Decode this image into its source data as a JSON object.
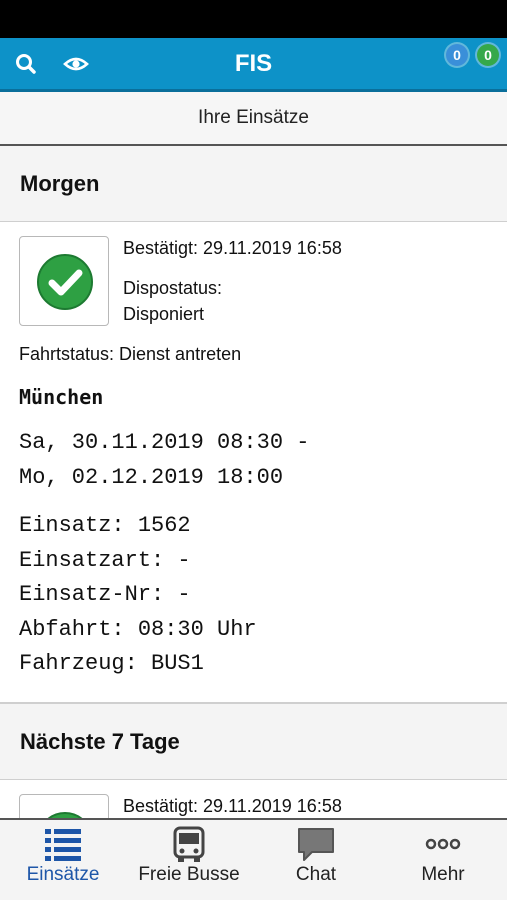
{
  "app": {
    "title": "FIS"
  },
  "header": {
    "badge_blue": "0",
    "badge_green": "0",
    "subtitle": "Ihre Einsätze"
  },
  "colors": {
    "appbar": "#0d92c8",
    "badge_blue": "#3a8fd9",
    "badge_green": "#35a84a",
    "status_green": "#2ea043",
    "tab_active": "#1e56a8"
  },
  "sections": [
    {
      "title": "Morgen",
      "card": {
        "confirmed": "Bestätigt: 29.11.2019 16:58",
        "dispo_label": "Dispostatus:",
        "dispo_value": "Disponiert",
        "fahrtstatus": "Fahrtstatus: Dienst antreten",
        "city": "München",
        "date_from": "Sa, 30.11.2019 08:30 -",
        "date_to": "Mo, 02.12.2019 18:00",
        "einsatz": "Einsatz: 1562",
        "einsatzart": "Einsatzart: -",
        "einsatz_nr": "Einsatz-Nr: -",
        "abfahrt": "Abfahrt: 08:30 Uhr",
        "fahrzeug": "Fahrzeug: BUS1"
      }
    },
    {
      "title": "Nächste 7 Tage",
      "card": {
        "confirmed": "Bestätigt: 29.11.2019 16:58"
      }
    }
  ],
  "tabs": [
    {
      "label": "Einsätze",
      "icon": "list-icon",
      "active": true
    },
    {
      "label": "Freie Busse",
      "icon": "bus-icon",
      "active": false
    },
    {
      "label": "Chat",
      "icon": "chat-icon",
      "active": false
    },
    {
      "label": "Mehr",
      "icon": "more-icon",
      "active": false
    }
  ]
}
